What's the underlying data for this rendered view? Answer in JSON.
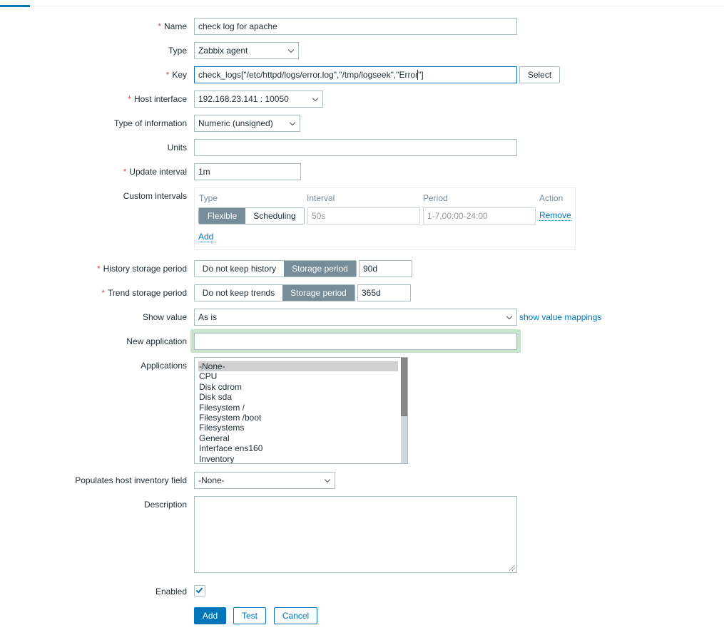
{
  "tabs": {
    "active_indicator": "active-tab"
  },
  "form": {
    "name": {
      "label": "Name",
      "required": "*",
      "value": "check log for apache"
    },
    "type": {
      "label": "Type",
      "value": "Zabbix agent"
    },
    "key": {
      "label": "Key",
      "required": "*",
      "value_before_caret": "check_logs[\"/etc/httpd/logs/error.log\",\"/tmp/logseek\",\"Error",
      "value_after_caret": "\"]",
      "select_button": "Select"
    },
    "host_interface": {
      "label": "Host interface",
      "required": "*",
      "value": "192.168.23.141 : 10050"
    },
    "type_of_information": {
      "label": "Type of information",
      "value": "Numeric (unsigned)"
    },
    "units": {
      "label": "Units",
      "value": ""
    },
    "update_interval": {
      "label": "Update interval",
      "required": "*",
      "value": "1m"
    },
    "custom_intervals": {
      "label": "Custom intervals",
      "headers": {
        "type": "Type",
        "interval": "Interval",
        "period": "Period",
        "action": "Action"
      },
      "rows": [
        {
          "type_options": [
            "Flexible",
            "Scheduling"
          ],
          "type_selected": "Flexible",
          "interval_placeholder": "50s",
          "period_placeholder": "1-7,00:00-24:00",
          "action": "Remove"
        }
      ],
      "add_link": "Add"
    },
    "history": {
      "label": "History storage period",
      "required": "*",
      "options": [
        "Do not keep history",
        "Storage period"
      ],
      "selected": "Storage period",
      "value": "90d"
    },
    "trend": {
      "label": "Trend storage period",
      "required": "*",
      "options": [
        "Do not keep trends",
        "Storage period"
      ],
      "selected": "Storage period",
      "value": "365d"
    },
    "show_value": {
      "label": "Show value",
      "value": "As is",
      "link": "show value mappings"
    },
    "new_application": {
      "label": "New application",
      "value": ""
    },
    "applications": {
      "label": "Applications",
      "options": [
        "-None-",
        "CPU",
        "Disk cdrom",
        "Disk sda",
        "Filesystem /",
        "Filesystem /boot",
        "Filesystems",
        "General",
        "Interface ens160",
        "Inventory"
      ],
      "selected": "-None-"
    },
    "inventory_field": {
      "label": "Populates host inventory field",
      "value": "-None-"
    },
    "description": {
      "label": "Description",
      "value": ""
    },
    "enabled": {
      "label": "Enabled",
      "checked": true
    }
  },
  "buttons": {
    "add": "Add",
    "test": "Test",
    "cancel": "Cancel"
  },
  "colors": {
    "accent": "#0275b8",
    "required": "#d64e4e",
    "segment_active": "#768d99",
    "focus_glow": "#c5e4cb"
  }
}
